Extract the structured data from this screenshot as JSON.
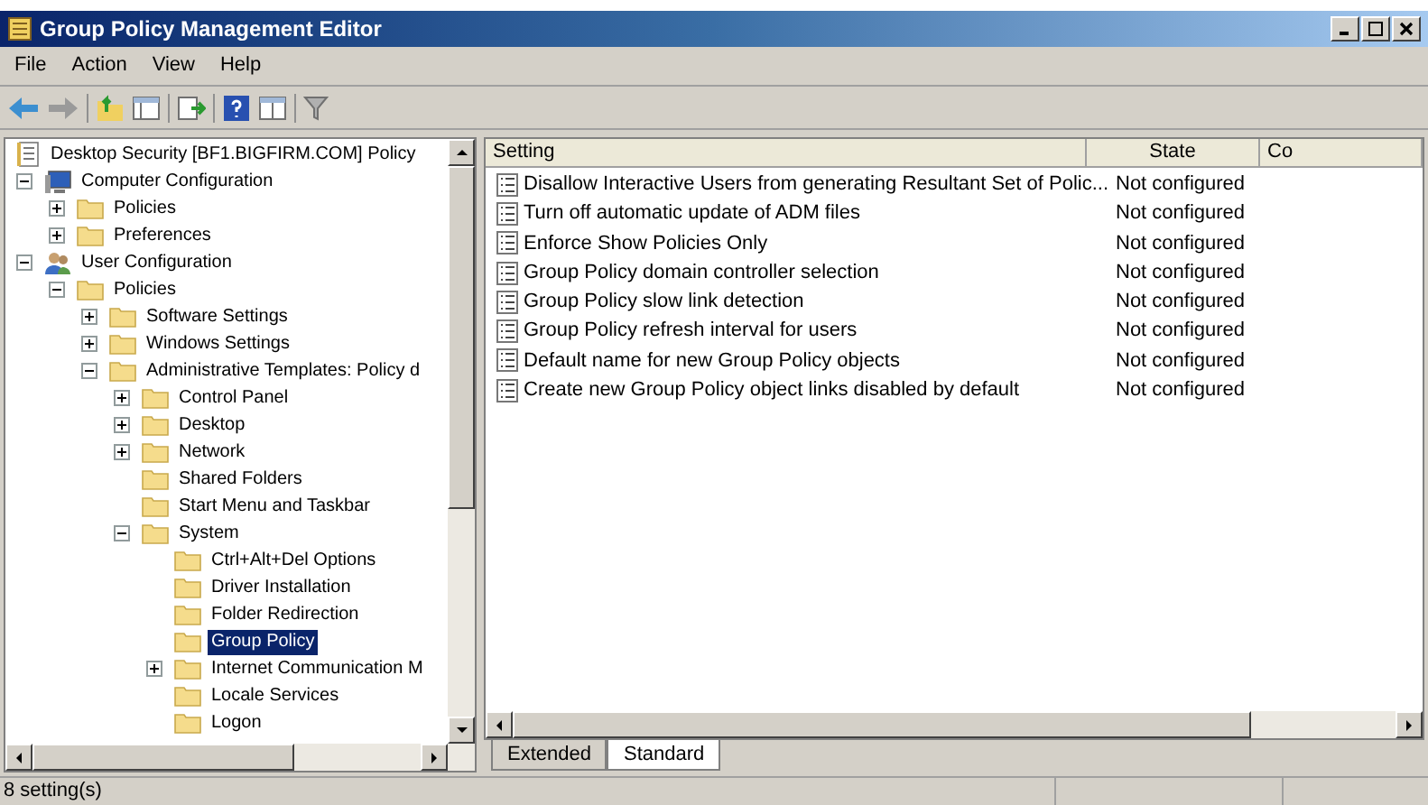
{
  "window": {
    "title": "Group Policy Management Editor"
  },
  "menu": [
    "File",
    "Action",
    "View",
    "Help"
  ],
  "tree": [
    {
      "label": "Desktop Security [BF1.BIGFIRM.COM] Policy",
      "kind": "policy",
      "selected": false,
      "children": [
        {
          "label": "Computer Configuration",
          "kind": "computer",
          "selected": false,
          "expanded": true,
          "children": [
            {
              "label": "Policies",
              "kind": "folder",
              "selected": false,
              "expanded": false
            },
            {
              "label": "Preferences",
              "kind": "folder",
              "selected": false,
              "expanded": false
            }
          ]
        },
        {
          "label": "User Configuration",
          "kind": "user",
          "selected": false,
          "expanded": true,
          "children": [
            {
              "label": "Policies",
              "kind": "folder",
              "selected": false,
              "expanded": true,
              "children": [
                {
                  "label": "Software Settings",
                  "kind": "folder",
                  "selected": false,
                  "expanded": false
                },
                {
                  "label": "Windows Settings",
                  "kind": "folder",
                  "selected": false,
                  "expanded": false
                },
                {
                  "label": "Administrative Templates: Policy d",
                  "kind": "folder",
                  "selected": false,
                  "expanded": true,
                  "children": [
                    {
                      "label": "Control Panel",
                      "kind": "folder",
                      "selected": false,
                      "expanded": false
                    },
                    {
                      "label": "Desktop",
                      "kind": "folder",
                      "selected": false,
                      "expanded": false
                    },
                    {
                      "label": "Network",
                      "kind": "folder",
                      "selected": false,
                      "expanded": false
                    },
                    {
                      "label": "Shared Folders",
                      "kind": "folder",
                      "selected": false
                    },
                    {
                      "label": "Start Menu and Taskbar",
                      "kind": "folder",
                      "selected": false
                    },
                    {
                      "label": "System",
                      "kind": "folder",
                      "selected": false,
                      "expanded": true,
                      "children": [
                        {
                          "label": "Ctrl+Alt+Del Options",
                          "kind": "folder",
                          "selected": false
                        },
                        {
                          "label": "Driver Installation",
                          "kind": "folder",
                          "selected": false
                        },
                        {
                          "label": "Folder Redirection",
                          "kind": "folder",
                          "selected": false
                        },
                        {
                          "label": "Group Policy",
                          "kind": "folder",
                          "selected": true
                        },
                        {
                          "label": "Internet Communication M",
                          "kind": "folder",
                          "selected": false,
                          "expanded": false
                        },
                        {
                          "label": "Locale Services",
                          "kind": "folder",
                          "selected": false
                        },
                        {
                          "label": "Logon",
                          "kind": "folder",
                          "selected": false
                        }
                      ]
                    }
                  ]
                }
              ]
            }
          ]
        }
      ]
    }
  ],
  "table": {
    "columns": [
      "Setting",
      "State",
      "Co"
    ],
    "rows": [
      {
        "setting": "Disallow Interactive Users from generating Resultant Set of Polic...",
        "state": "Not configured"
      },
      {
        "setting": "Turn off automatic update of ADM files",
        "state": "Not configured"
      },
      {
        "setting": "Enforce Show Policies Only",
        "state": "Not configured"
      },
      {
        "setting": "Group Policy domain controller selection",
        "state": "Not configured"
      },
      {
        "setting": "Group Policy slow link detection",
        "state": "Not configured"
      },
      {
        "setting": "Group Policy refresh interval for users",
        "state": "Not configured"
      },
      {
        "setting": "Default name for new Group Policy objects",
        "state": "Not configured"
      },
      {
        "setting": "Create new Group Policy object links disabled by default",
        "state": "Not configured"
      }
    ]
  },
  "view_tabs": [
    {
      "label": "Extended",
      "selected": false
    },
    {
      "label": "Standard",
      "selected": true
    }
  ],
  "status_bar": "8 setting(s)"
}
